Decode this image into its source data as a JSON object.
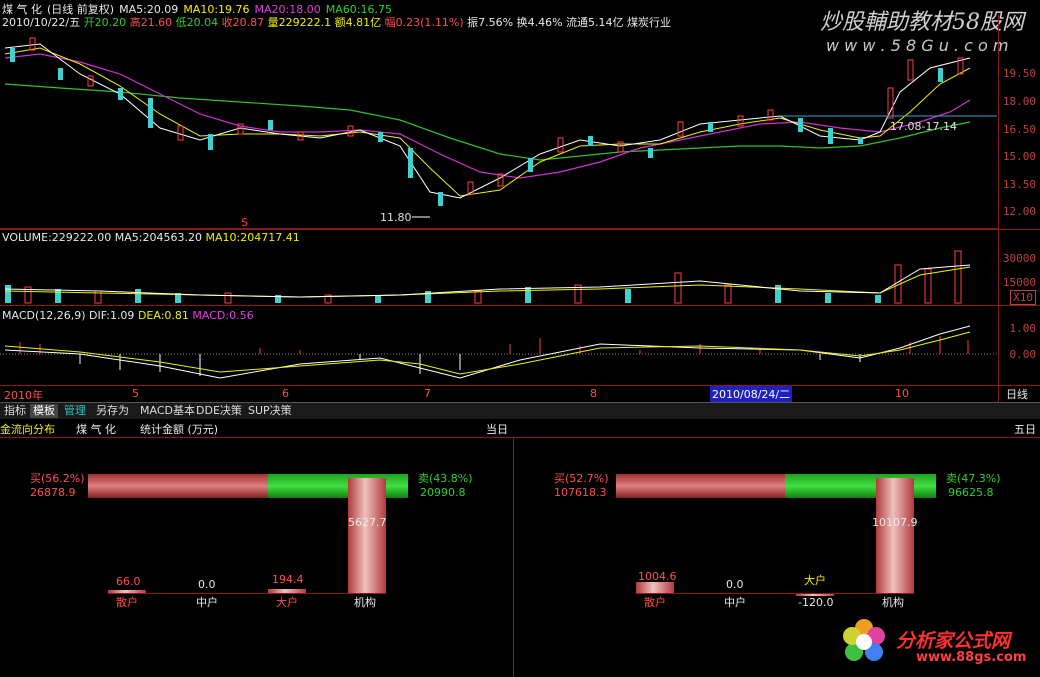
{
  "header": {
    "stock": "煤 气 化",
    "period": "(日线 前复权)",
    "ma5": "MA5:20.09",
    "ma10": "MA10:19.76",
    "ma20": "MA20:18.00",
    "ma60": "MA60:16.75",
    "watermark_top": "炒股輔助教材58股网",
    "watermark_url": "w w w . 5 8 G u . c o m"
  },
  "quote": {
    "date": "2010/10/22/五",
    "open": "开20.20",
    "high": "高21.60",
    "low": "低20.04",
    "close": "收20.87",
    "volume": "量229222.1",
    "amount": "额4.81亿",
    "change": "幅0.23(1.11%)",
    "amplitude": "振7.56%",
    "turnover": "换4.46%",
    "float": "流通5.14亿",
    "industry": "煤炭行业"
  },
  "price_axis": [
    "19.50",
    "18.00",
    "16.50",
    "15.00",
    "13.50",
    "12.00"
  ],
  "annotations": {
    "low_mark": "11.80",
    "range_mark": "17.08-17.14",
    "s_mark": "S"
  },
  "volume": {
    "title": "VOLUME:229222.00",
    "ma5": "MA5:204563.20",
    "ma10": "MA10:204717.41",
    "axis": [
      "30000",
      "15000"
    ],
    "unit": "X10"
  },
  "macd": {
    "title": "MACD(12,26,9)",
    "dif": "DIF:1.09",
    "dea": "DEA:0.81",
    "macd": "MACD:0.56",
    "axis": [
      "1.00",
      "0.00"
    ]
  },
  "time_axis": {
    "labels": [
      "2010年",
      "5",
      "6",
      "7",
      "8",
      "10"
    ],
    "cursor": "2010/08/24/二",
    "period": "日线"
  },
  "tabs": [
    "指标",
    "模板",
    "管理",
    "另存为",
    "MACD基本",
    "DDE决策",
    "SUP决策"
  ],
  "fund_flow": {
    "title": "金流向分布",
    "stock": "煤 气 化",
    "unit": "统计金额 (万元)",
    "today_label": "当日",
    "five_day_label": "五日",
    "today": {
      "buy_label": "买(56.2%)",
      "buy_value": "26878.9",
      "sell_label": "卖(43.8%)",
      "sell_value": "20990.8",
      "buy_pct": 56.2,
      "bars": [
        {
          "name": "散户",
          "value": "66.0",
          "num": 66.0
        },
        {
          "name": "中户",
          "value": "0.0",
          "num": 0.0
        },
        {
          "name": "大户",
          "value": "194.4",
          "num": 194.4
        },
        {
          "name": "机构",
          "value": "5627.7",
          "num": 5627.7
        }
      ]
    },
    "five_day": {
      "buy_label": "买(52.7%)",
      "buy_value": "107618.3",
      "sell_label": "卖(47.3%)",
      "sell_value": "96625.8",
      "buy_pct": 52.7,
      "bars": [
        {
          "name": "散户",
          "value": "1004.6",
          "num": 1004.6
        },
        {
          "name": "中户",
          "value": "0.0",
          "num": 0.0
        },
        {
          "name": "大户",
          "value": "-120.0",
          "num": -120.0
        },
        {
          "name": "机构",
          "value": "10107.9",
          "num": 10107.9
        }
      ]
    }
  },
  "watermark_bottom": {
    "title": "分析家公式网",
    "url": "www.88gs.com"
  }
}
